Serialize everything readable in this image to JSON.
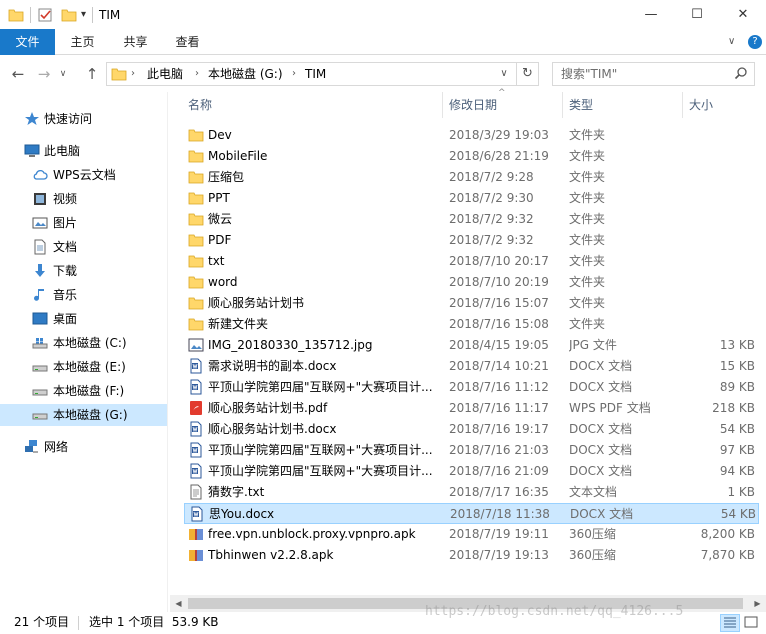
{
  "window": {
    "title": "TIM",
    "minimize_glyph": "—",
    "maximize_glyph": "☐",
    "close_glyph": "✕"
  },
  "ribbon": {
    "tabs": [
      "文件",
      "主页",
      "共享",
      "查看"
    ],
    "expand_glyph": "∨",
    "help_glyph": "?"
  },
  "address": {
    "back_glyph": "←",
    "forward_glyph": "→",
    "recent_glyph": "∨",
    "up_glyph": "↑",
    "crumbs": [
      "此电脑",
      "本地磁盘 (G:)",
      "TIM"
    ],
    "separator": "›",
    "dropdown_glyph": "∨",
    "refresh_glyph": "↻"
  },
  "search": {
    "placeholder": "搜索\"TIM\""
  },
  "nav": {
    "quick_access": "快速访问",
    "this_pc": "此电脑",
    "items": [
      "WPS云文档",
      "视频",
      "图片",
      "文档",
      "下载",
      "音乐",
      "桌面",
      "本地磁盘 (C:)",
      "本地磁盘 (E:)",
      "本地磁盘 (F:)",
      "本地磁盘 (G:)"
    ],
    "network": "网络",
    "selected": "本地磁盘 (G:)"
  },
  "columns": {
    "name": "名称",
    "date": "修改日期",
    "type": "类型",
    "size": "大小",
    "sort_glyph": "^"
  },
  "files": [
    {
      "name": "Dev",
      "date": "2018/3/29 19:03",
      "type": "文件夹",
      "size": "",
      "icon": "folder-icon"
    },
    {
      "name": "MobileFile",
      "date": "2018/6/28 21:19",
      "type": "文件夹",
      "size": "",
      "icon": "folder-icon"
    },
    {
      "name": "压缩包",
      "date": "2018/7/2 9:28",
      "type": "文件夹",
      "size": "",
      "icon": "folder-icon"
    },
    {
      "name": "PPT",
      "date": "2018/7/2 9:30",
      "type": "文件夹",
      "size": "",
      "icon": "folder-icon"
    },
    {
      "name": "微云",
      "date": "2018/7/2 9:32",
      "type": "文件夹",
      "size": "",
      "icon": "folder-icon"
    },
    {
      "name": "PDF",
      "date": "2018/7/2 9:32",
      "type": "文件夹",
      "size": "",
      "icon": "folder-icon"
    },
    {
      "name": "txt",
      "date": "2018/7/10 20:17",
      "type": "文件夹",
      "size": "",
      "icon": "folder-icon"
    },
    {
      "name": "word",
      "date": "2018/7/10 20:19",
      "type": "文件夹",
      "size": "",
      "icon": "folder-icon"
    },
    {
      "name": "顺心服务站计划书",
      "date": "2018/7/16 15:07",
      "type": "文件夹",
      "size": "",
      "icon": "folder-icon"
    },
    {
      "name": "新建文件夹",
      "date": "2018/7/16 15:08",
      "type": "文件夹",
      "size": "",
      "icon": "folder-icon"
    },
    {
      "name": "IMG_20180330_135712.jpg",
      "date": "2018/4/15 19:05",
      "type": "JPG 文件",
      "size": "13 KB",
      "icon": "image-file-icon"
    },
    {
      "name": "需求说明书的副本.docx",
      "date": "2018/7/14 10:21",
      "type": "DOCX 文档",
      "size": "15 KB",
      "icon": "docx-file-icon"
    },
    {
      "name": "平顶山学院第四届\"互联网+\"大赛项目计...",
      "date": "2018/7/16 11:12",
      "type": "DOCX 文档",
      "size": "89 KB",
      "icon": "docx-file-icon"
    },
    {
      "name": "顺心服务站计划书.pdf",
      "date": "2018/7/16 11:17",
      "type": "WPS PDF 文档",
      "size": "218 KB",
      "icon": "pdf-file-icon"
    },
    {
      "name": "顺心服务站计划书.docx",
      "date": "2018/7/16 19:17",
      "type": "DOCX 文档",
      "size": "54 KB",
      "icon": "docx-file-icon"
    },
    {
      "name": "平顶山学院第四届\"互联网+\"大赛项目计...",
      "date": "2018/7/16 21:03",
      "type": "DOCX 文档",
      "size": "97 KB",
      "icon": "docx-file-icon"
    },
    {
      "name": "平顶山学院第四届\"互联网+\"大赛项目计...",
      "date": "2018/7/16 21:09",
      "type": "DOCX 文档",
      "size": "94 KB",
      "icon": "docx-file-icon"
    },
    {
      "name": "猜数字.txt",
      "date": "2018/7/17 16:35",
      "type": "文本文档",
      "size": "1 KB",
      "icon": "text-file-icon"
    },
    {
      "name": "思You.docx",
      "date": "2018/7/18 11:38",
      "type": "DOCX 文档",
      "size": "54 KB",
      "icon": "docx-file-icon",
      "selected": true
    },
    {
      "name": "free.vpn.unblock.proxy.vpnpro.apk",
      "date": "2018/7/19 19:11",
      "type": "360压缩",
      "size": "8,200 KB",
      "icon": "archive-file-icon"
    },
    {
      "name": "Tbhinwen v2.2.8.apk",
      "date": "2018/7/19 19:13",
      "type": "360压缩",
      "size": "7,870 KB",
      "icon": "archive-file-icon"
    }
  ],
  "status": {
    "count": "21 个项目",
    "selection": "选中 1 个项目  53.9 KB"
  },
  "watermark": "https://blog.csdn.net/qq_4126...5"
}
